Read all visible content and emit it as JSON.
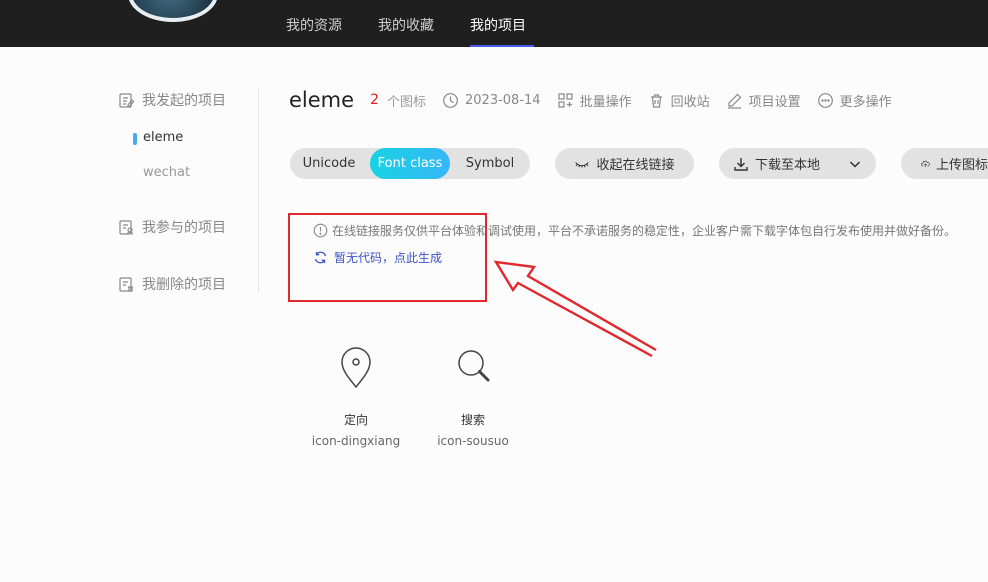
{
  "topnav": {
    "items": [
      {
        "label": "我的资源"
      },
      {
        "label": "我的收藏"
      },
      {
        "label": "我的项目",
        "active": true
      }
    ],
    "active_color": "#4a5cf0"
  },
  "sidebar": {
    "groups": [
      {
        "label": "我发起的项目",
        "items": [
          {
            "label": "eleme",
            "active": true
          },
          {
            "label": "wechat"
          }
        ]
      },
      {
        "label": "我参与的项目"
      },
      {
        "label": "我删除的项目"
      }
    ]
  },
  "project": {
    "name": "eleme",
    "icon_count": "2",
    "icon_count_unit": "个图标",
    "date": "2023-08-14",
    "actions": {
      "batch": "批量操作",
      "recycle": "回收站",
      "settings": "项目设置",
      "more": "更多操作"
    }
  },
  "tabs": {
    "unicode": "Unicode",
    "font_class": "Font class",
    "symbol": "Symbol",
    "active": "Font class",
    "active_gradient": [
      "#19d3e3",
      "#36b6f7"
    ]
  },
  "buttons": {
    "collapse_link": "收起在线链接",
    "download": "下载至本地",
    "upload": "上传图标"
  },
  "notice": {
    "text": "在线链接服务仅供平台体验和调试使用，平台不承诺服务的稳定性，企业客户需下载字体包自行发布使用并做好备份。",
    "generate_link": "暂无代码，点此生成"
  },
  "annotation": {
    "color": "#e0282e"
  },
  "icons": [
    {
      "name": "定向",
      "code": "icon-dingxiang",
      "glyph": "location-pin-icon"
    },
    {
      "name": "搜索",
      "code": "icon-sousuo",
      "glyph": "search-icon"
    }
  ]
}
